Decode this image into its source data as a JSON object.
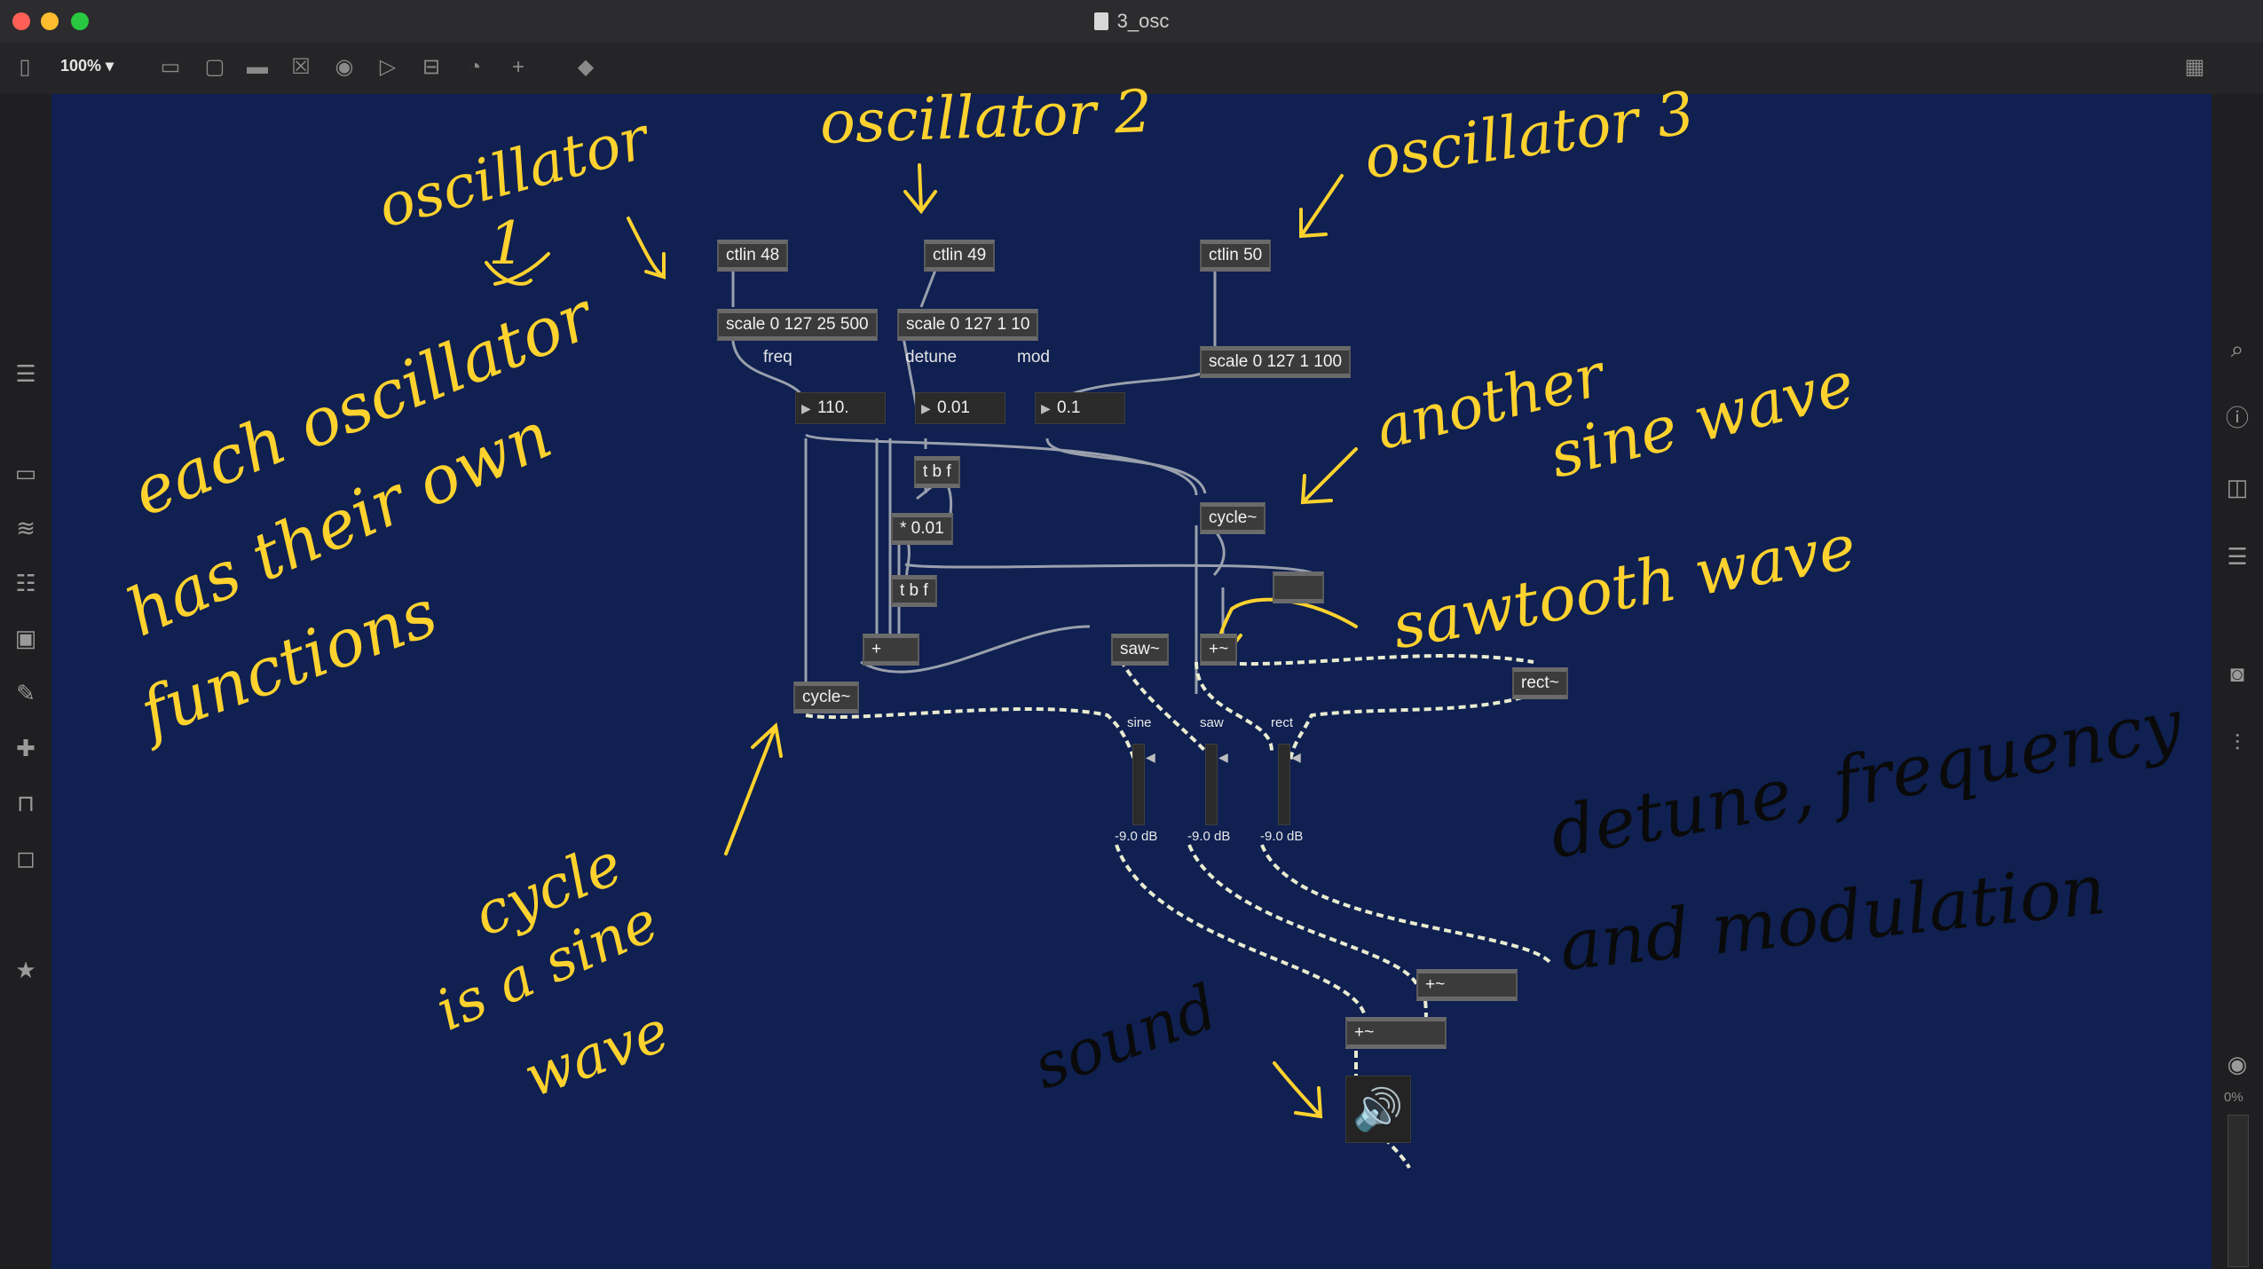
{
  "window": {
    "title": "3_osc",
    "zoom": "100%"
  },
  "toolbar": {
    "icons": [
      "sidebar-toggle-icon",
      "object-icon",
      "message-icon",
      "comment-icon",
      "button-icon",
      "toggle-icon",
      "number-icon",
      "slider-icon",
      "dial-icon",
      "add-icon",
      "paint-bucket-icon",
      "grid-icon"
    ]
  },
  "patch": {
    "objects": {
      "ctlin48": "ctlin 48",
      "ctlin49": "ctlin 49",
      "ctlin50": "ctlin 50",
      "scale1": "scale 0 127 25 500",
      "scale2": "scale 0 127 1 10",
      "scale3": "scale 0 127 1 100",
      "tbf1": "t b f",
      "mul": "* 0.01",
      "tbf2": "t b f",
      "plus": "+",
      "cycle1": "cycle~",
      "cycle2": "cycle~",
      "saw": "saw~",
      "plussig1": "+~",
      "rect": "rect~",
      "plussig2": "+~",
      "plussig3": "+~"
    },
    "numbers": {
      "freq": "110.",
      "detune": "0.01",
      "mod": "0.1"
    },
    "labels": {
      "freq": "freq",
      "detune": "detune",
      "mod": "mod"
    },
    "mixer": {
      "sine": {
        "name": "sine",
        "gain": "-9.0 dB"
      },
      "saw": {
        "name": "saw",
        "gain": "-9.0 dB"
      },
      "rect": {
        "name": "rect",
        "gain": "-9.0 dB"
      }
    }
  },
  "annotations": {
    "osc1": "oscillator",
    "osc1_num": "1",
    "osc2": "oscillator 2",
    "osc3": "oscillator 3",
    "each1": "each oscillator",
    "each2": "has their own",
    "each3": "functions",
    "another": "another",
    "sine_wave": "sine wave",
    "sawtooth": "sawtooth wave",
    "cycle1": "cycle",
    "cycle2": "is a sine",
    "cycle3": "wave",
    "sound": "sound",
    "detune1": "detune, frequency",
    "detune2": "and modulation"
  },
  "rightbar": {
    "percent": "0%"
  }
}
